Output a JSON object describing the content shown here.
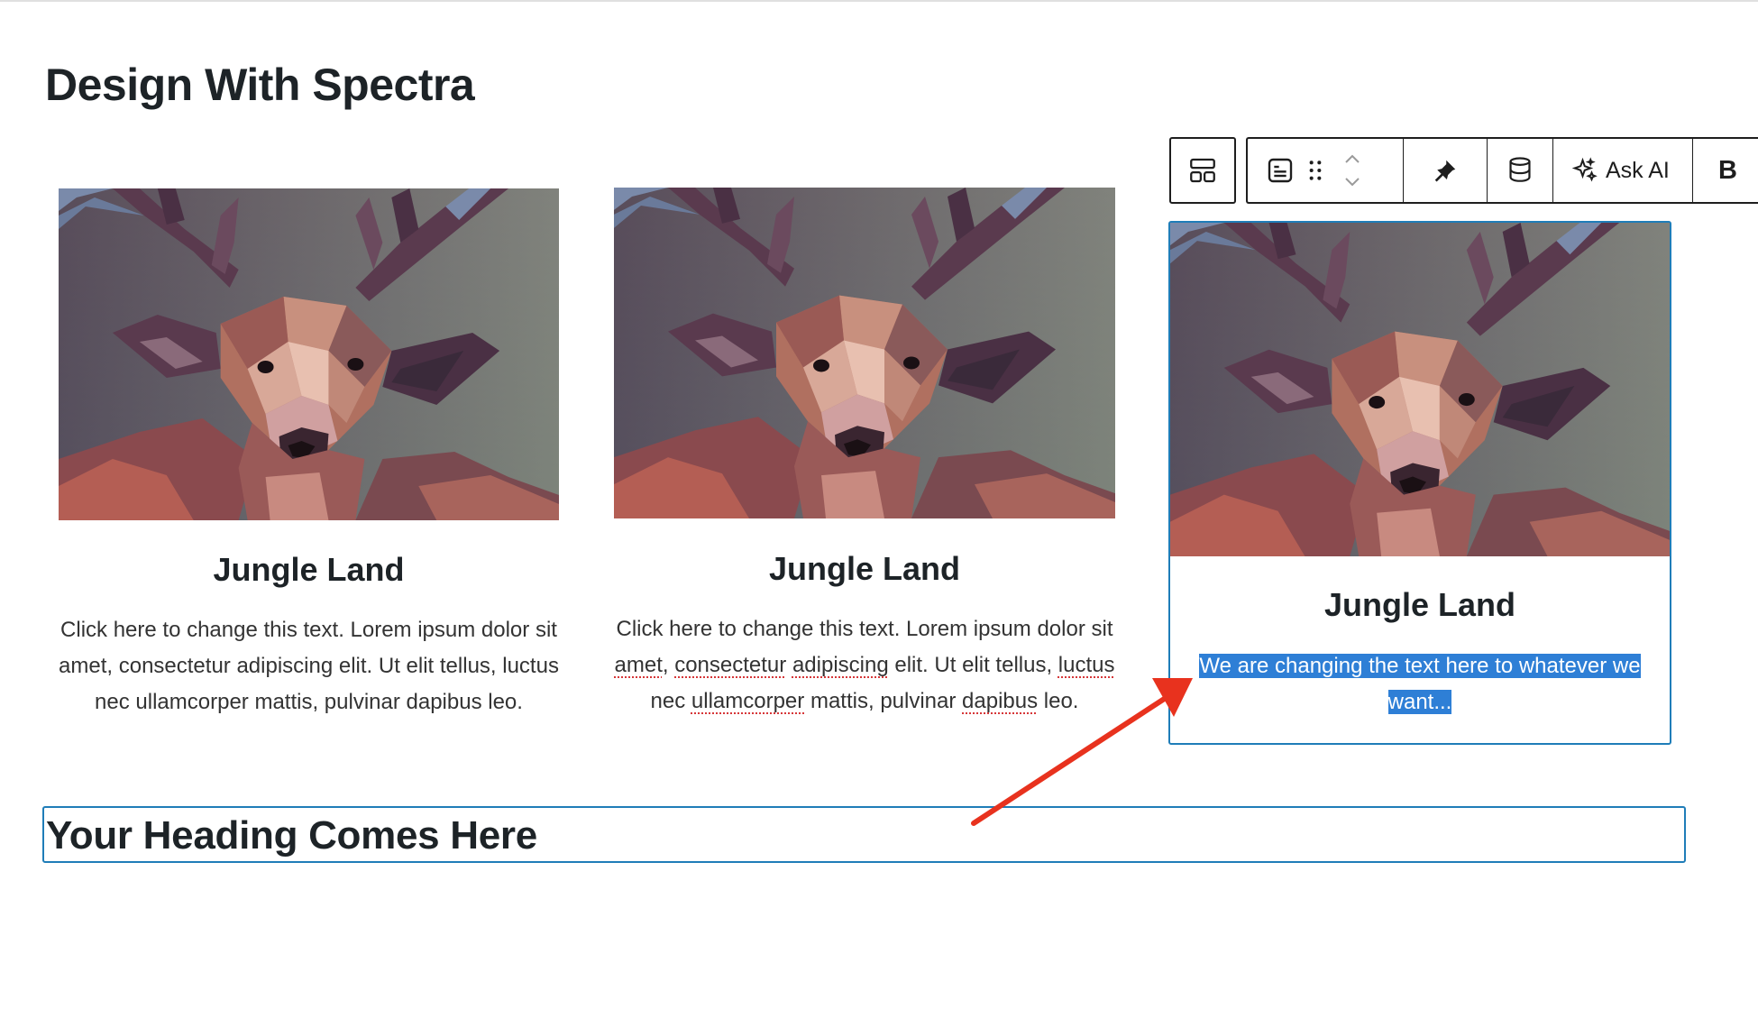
{
  "page": {
    "title": "Design With Spectra"
  },
  "cards": [
    {
      "title": "Jungle Land",
      "text": "Click here to change this text. Lorem ipsum dolor sit amet, consectetur adipiscing elit. Ut elit tellus, luctus nec ullamcorper mattis, pulvinar dapibus leo."
    },
    {
      "title": "Jungle Land",
      "text": "Click here to change this text. Lorem ipsum dolor sit amet, consectetur adipiscing elit. Ut elit tellus, luctus nec ullamcorper mattis, pulvinar dapibus leo."
    },
    {
      "title": "Jungle Land",
      "text": "We are changing the text here to whatever we want..."
    }
  ],
  "toolbar": {
    "parent_icon": "select-parent-icon",
    "block_type_icon": "info-box-icon",
    "drag_icon": "drag-handle-icon",
    "move_up_icon": "chevron-up-icon",
    "move_down_icon": "chevron-down-icon",
    "pin_icon": "pin-icon",
    "dynamic_content_icon": "database-icon",
    "ask_ai_icon": "sparkles-icon",
    "ask_ai_label": "Ask AI",
    "bold_label": "B"
  },
  "heading_block": {
    "text": "Your Heading Comes Here"
  },
  "colors": {
    "selection_border": "#1f7db8",
    "text_selection": "#2e7fd6",
    "annotation_arrow": "#e8321e",
    "heading_text": "#1d2327"
  }
}
